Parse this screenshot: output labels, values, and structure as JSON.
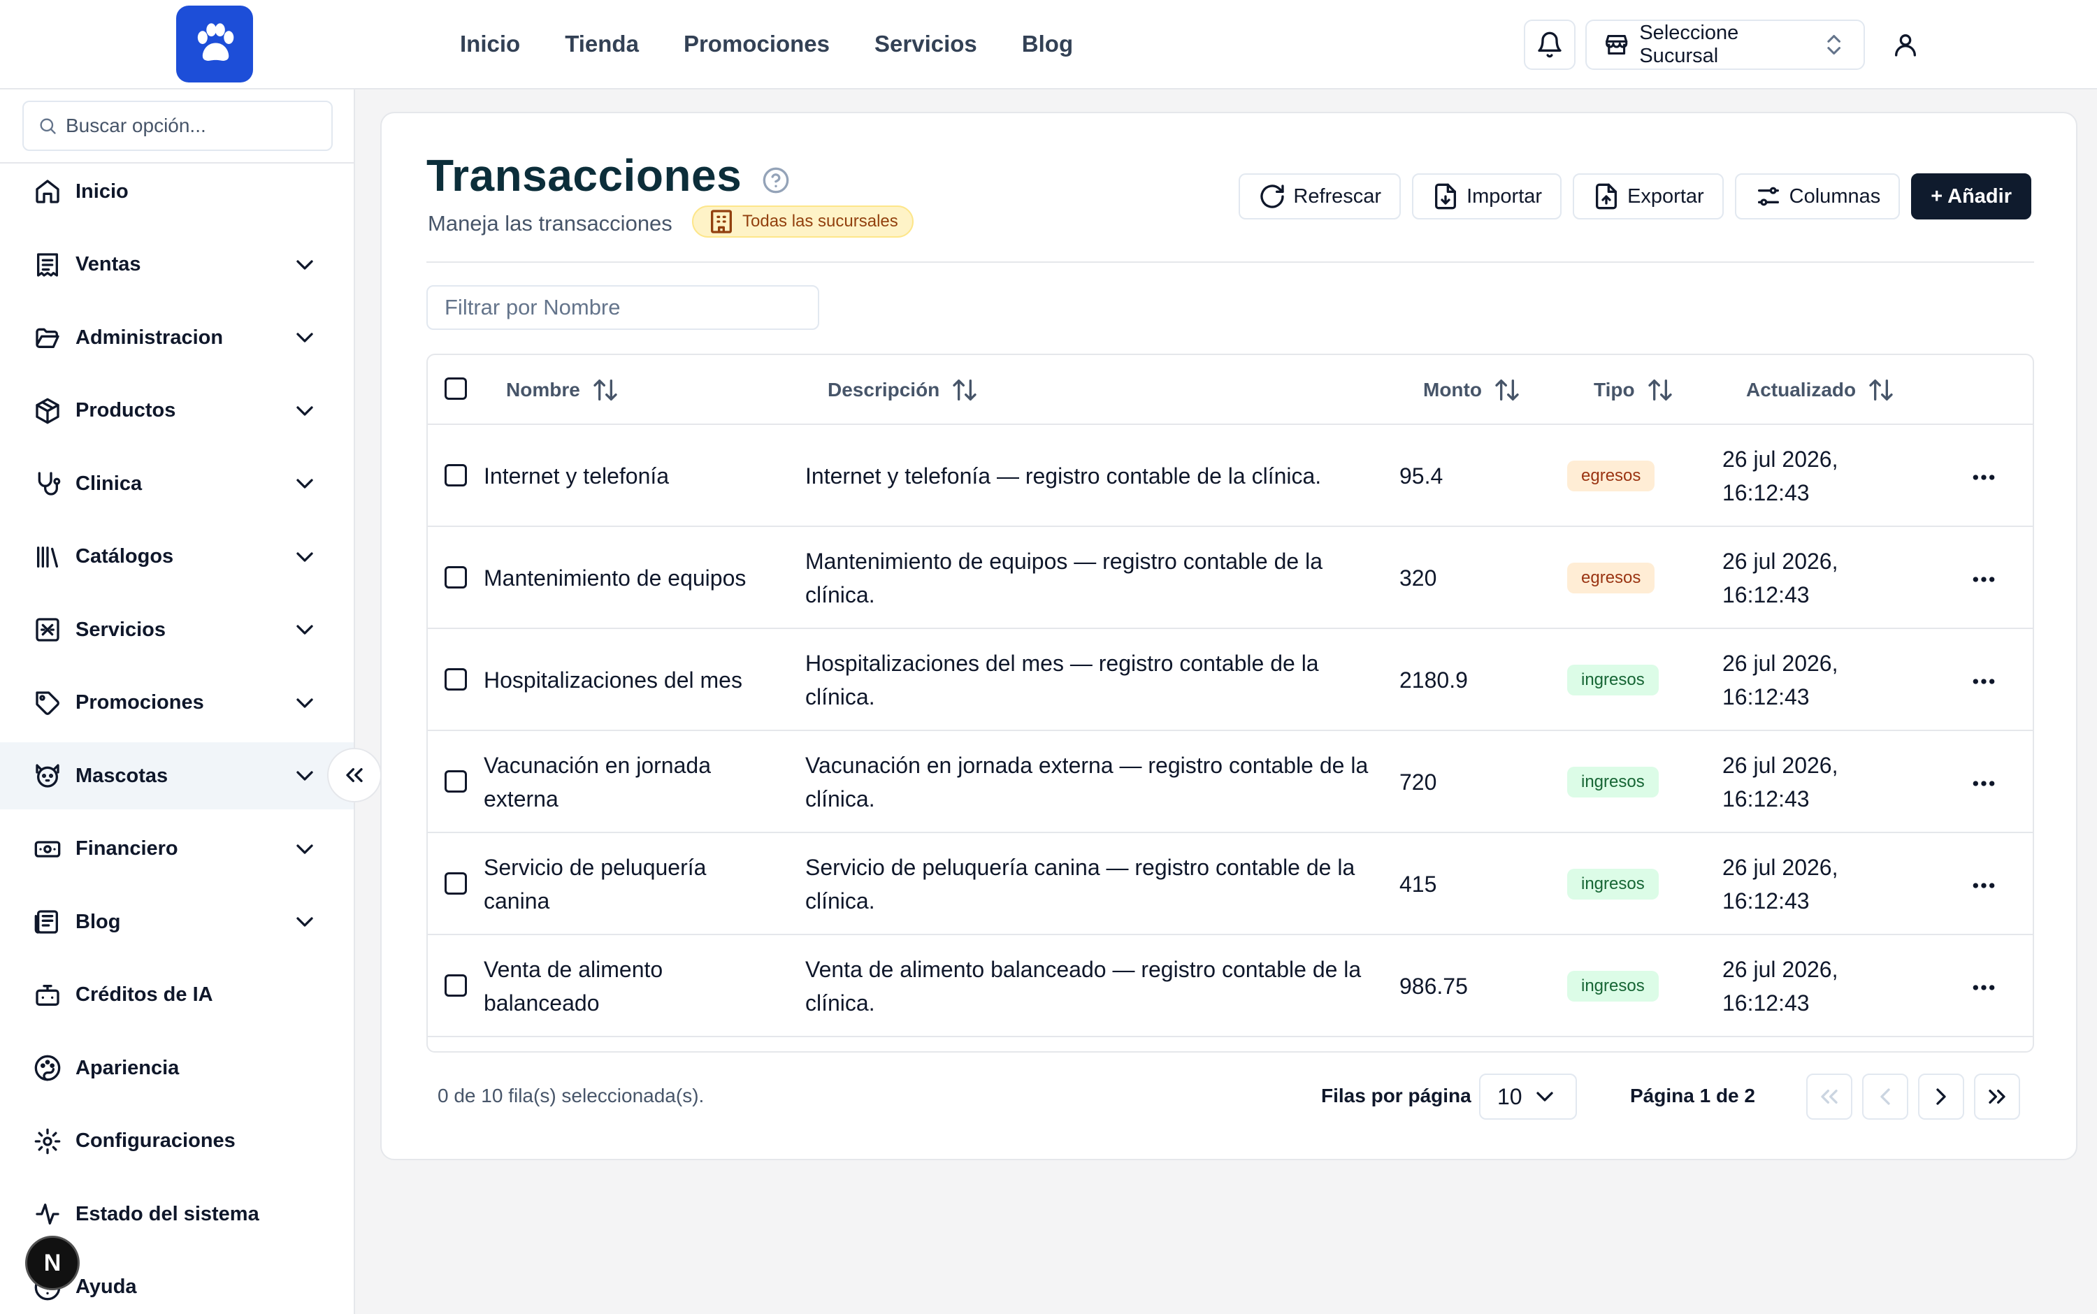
{
  "header": {
    "nav": [
      "Inicio",
      "Tienda",
      "Promociones",
      "Servicios",
      "Blog"
    ],
    "branch_selector": "Seleccione Sucursal"
  },
  "sidebar": {
    "search_placeholder": "Buscar opción...",
    "items": [
      {
        "label": "Inicio",
        "icon": "home-icon",
        "expandable": false
      },
      {
        "label": "Ventas",
        "icon": "receipt-icon",
        "expandable": true
      },
      {
        "label": "Administracion",
        "icon": "folder-open-icon",
        "expandable": true
      },
      {
        "label": "Productos",
        "icon": "package-icon",
        "expandable": true
      },
      {
        "label": "Clinica",
        "icon": "stethoscope-icon",
        "expandable": true
      },
      {
        "label": "Catálogos",
        "icon": "library-icon",
        "expandable": true
      },
      {
        "label": "Servicios",
        "icon": "services-icon",
        "expandable": true
      },
      {
        "label": "Promociones",
        "icon": "tag-icon",
        "expandable": true
      },
      {
        "label": "Mascotas",
        "icon": "dog-icon",
        "expandable": true,
        "active": true
      },
      {
        "label": "Financiero",
        "icon": "banknote-icon",
        "expandable": true
      },
      {
        "label": "Blog",
        "icon": "newspaper-icon",
        "expandable": true
      },
      {
        "label": "Créditos de IA",
        "icon": "bot-icon",
        "expandable": false
      },
      {
        "label": "Apariencia",
        "icon": "palette-icon",
        "expandable": false
      },
      {
        "label": "Configuraciones",
        "icon": "gear-icon",
        "expandable": false
      },
      {
        "label": "Estado del sistema",
        "icon": "activity-icon",
        "expandable": false
      },
      {
        "label": "Ayuda",
        "icon": "help-circle-icon",
        "expandable": false
      }
    ],
    "dev_badge": "N"
  },
  "page": {
    "title": "Transacciones",
    "subtitle": "Maneja las transacciones",
    "scope_badge": "Todas las sucursales",
    "toolbar": {
      "refresh": "Refrescar",
      "import": "Importar",
      "export": "Exportar",
      "columns": "Columnas",
      "add": "+ Añadir"
    },
    "filter_placeholder": "Filtrar por Nombre"
  },
  "table": {
    "columns": [
      "Nombre",
      "Descripción",
      "Monto",
      "Tipo",
      "Actualizado"
    ],
    "rows": [
      {
        "nombre": "Internet y telefonía",
        "descripcion": "Internet y telefonía — registro contable de la clínica.",
        "monto": "95.4",
        "tipo": "egresos",
        "actualizado": "26 jul 2026, 16:12:43"
      },
      {
        "nombre": "Mantenimiento de equipos",
        "descripcion": "Mantenimiento de equipos — registro contable de la clínica.",
        "monto": "320",
        "tipo": "egresos",
        "actualizado": "26 jul 2026, 16:12:43"
      },
      {
        "nombre": "Hospitalizaciones del mes",
        "descripcion": "Hospitalizaciones del mes — registro contable de la clínica.",
        "monto": "2180.9",
        "tipo": "ingresos",
        "actualizado": "26 jul 2026, 16:12:43"
      },
      {
        "nombre": "Vacunación en jornada externa",
        "descripcion": "Vacunación en jornada externa — registro contable de la clínica.",
        "monto": "720",
        "tipo": "ingresos",
        "actualizado": "26 jul 2026, 16:12:43"
      },
      {
        "nombre": "Servicio de peluquería canina",
        "descripcion": "Servicio de peluquería canina — registro contable de la clínica.",
        "monto": "415",
        "tipo": "ingresos",
        "actualizado": "26 jul 2026, 16:12:43"
      },
      {
        "nombre": "Venta de alimento balanceado",
        "descripcion": "Venta de alimento balanceado — registro contable de la clínica.",
        "monto": "986.75",
        "tipo": "ingresos",
        "actualizado": "26 jul 2026, 16:12:43"
      }
    ]
  },
  "footer": {
    "selection": "0 de 10 fila(s) seleccionada(s).",
    "rows_per_page_label": "Filas por página",
    "rows_per_page": "10",
    "page_info": "Página 1 de 2"
  },
  "colors": {
    "logo_bg": "#1d4ed8",
    "primary_button": "#0f1b2d",
    "egresos_bg": "#ffedd5",
    "ingresos_bg": "#dcfce7",
    "scope_badge_bg": "#fef3c7"
  }
}
